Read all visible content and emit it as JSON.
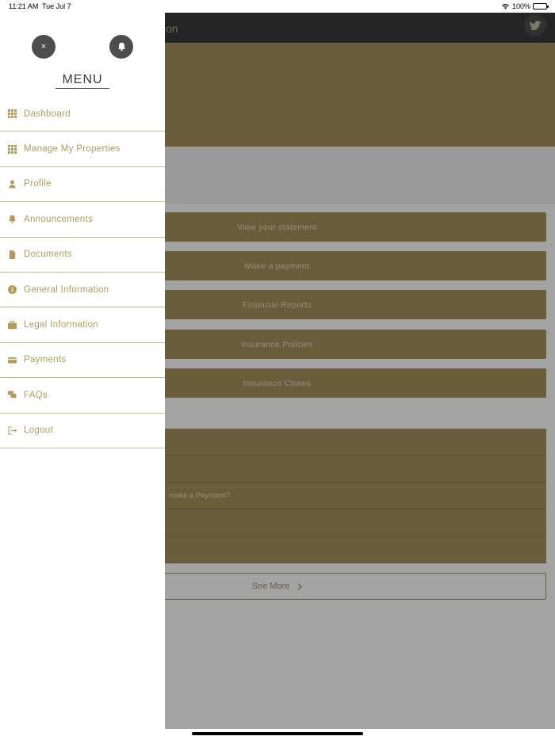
{
  "status_bar": {
    "time": "11:21 AM",
    "date": "Tue Jul 7",
    "battery": "100%"
  },
  "app": {
    "title_fragment": "on",
    "actions": [
      {
        "label": "View your statement"
      },
      {
        "label": "Make a payment"
      },
      {
        "label": "Financial Reports"
      },
      {
        "label": "Insurance Policies"
      },
      {
        "label": "Insurance Claims"
      }
    ],
    "faq_rows": [
      {
        "text": ""
      },
      {
        "text": ""
      },
      {
        "text": "make a Payment?"
      },
      {
        "text": ""
      },
      {
        "text": ""
      }
    ],
    "see_more_label": "See More"
  },
  "drawer": {
    "close_glyph": "×",
    "menu_title": "MENU",
    "items": [
      {
        "label": "Dashboard",
        "icon": "grid-icon"
      },
      {
        "label": "Manage My Properties",
        "icon": "grid-icon"
      },
      {
        "label": "Profile",
        "icon": "user-icon"
      },
      {
        "label": "Announcements",
        "icon": "bell-icon"
      },
      {
        "label": "Documents",
        "icon": "document-icon"
      },
      {
        "label": "General Information",
        "icon": "info-icon"
      },
      {
        "label": "Legal Information",
        "icon": "briefcase-icon"
      },
      {
        "label": "Payments",
        "icon": "credit-card-icon"
      },
      {
        "label": "FAQs",
        "icon": "chat-icon"
      },
      {
        "label": "Logout",
        "icon": "logout-icon"
      }
    ]
  },
  "colors": {
    "accent": "#b19a5d",
    "button": "#a6925f",
    "dark": "#4d4d4d"
  }
}
